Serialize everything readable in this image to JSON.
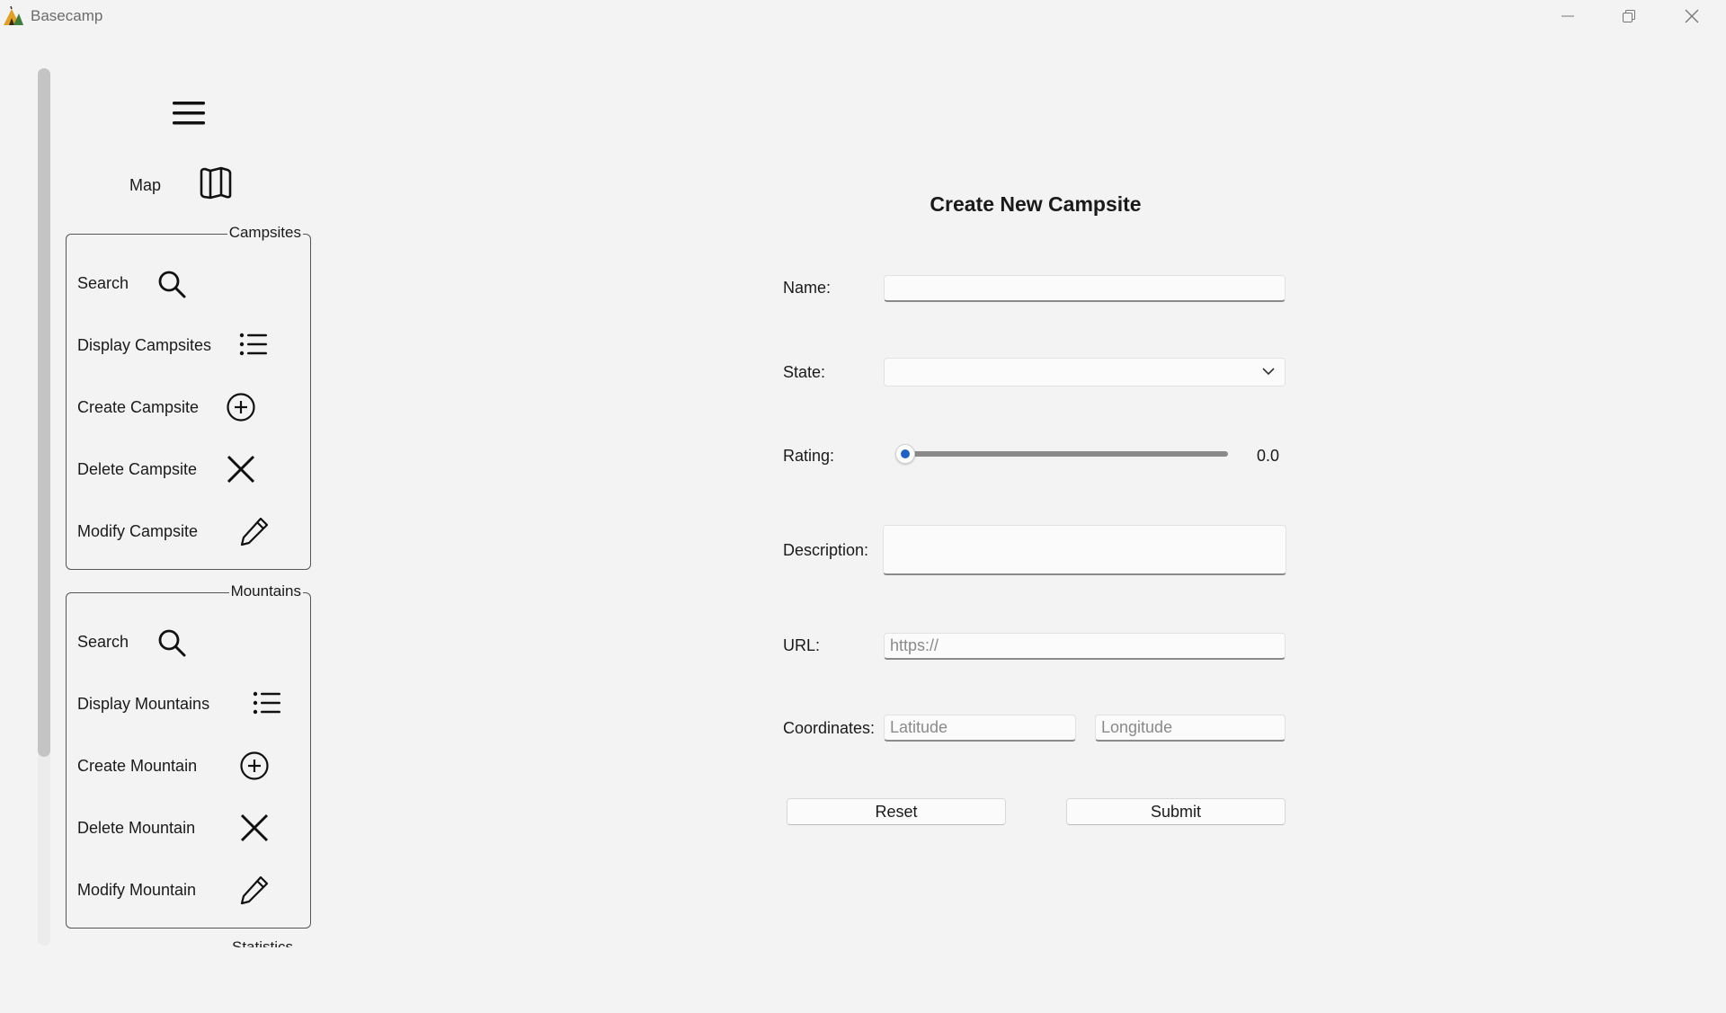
{
  "window": {
    "title": "Basecamp"
  },
  "sidebar": {
    "map_label": "Map",
    "campsites": {
      "title": "Campsites",
      "items": [
        {
          "label": "Search",
          "icon": "search-icon"
        },
        {
          "label": "Display Campsites",
          "icon": "list-icon"
        },
        {
          "label": "Create Campsite",
          "icon": "add-circle-icon"
        },
        {
          "label": "Delete Campsite",
          "icon": "close-icon"
        },
        {
          "label": "Modify Campsite",
          "icon": "pencil-icon"
        }
      ]
    },
    "mountains": {
      "title": "Mountains",
      "items": [
        {
          "label": "Search",
          "icon": "search-icon"
        },
        {
          "label": "Display Mountains",
          "icon": "list-icon"
        },
        {
          "label": "Create Mountain",
          "icon": "add-circle-icon"
        },
        {
          "label": "Delete Mountain",
          "icon": "close-icon"
        },
        {
          "label": "Modify Mountain",
          "icon": "pencil-icon"
        }
      ]
    },
    "next_group_partial": "Statistics"
  },
  "form": {
    "title": "Create New Campsite",
    "name_label": "Name:",
    "name_value": "",
    "state_label": "State:",
    "state_value": "",
    "rating_label": "Rating:",
    "rating_value": "0.0",
    "rating_fraction": 0.0,
    "description_label": "Description:",
    "description_value": "",
    "url_label": "URL:",
    "url_placeholder": "https://",
    "coordinates_label": "Coordinates:",
    "latitude_placeholder": "Latitude",
    "longitude_placeholder": "Longitude",
    "reset_label": "Reset",
    "submit_label": "Submit"
  },
  "colors": {
    "accent": "#1e63c4",
    "background": "#f3f3f3"
  }
}
